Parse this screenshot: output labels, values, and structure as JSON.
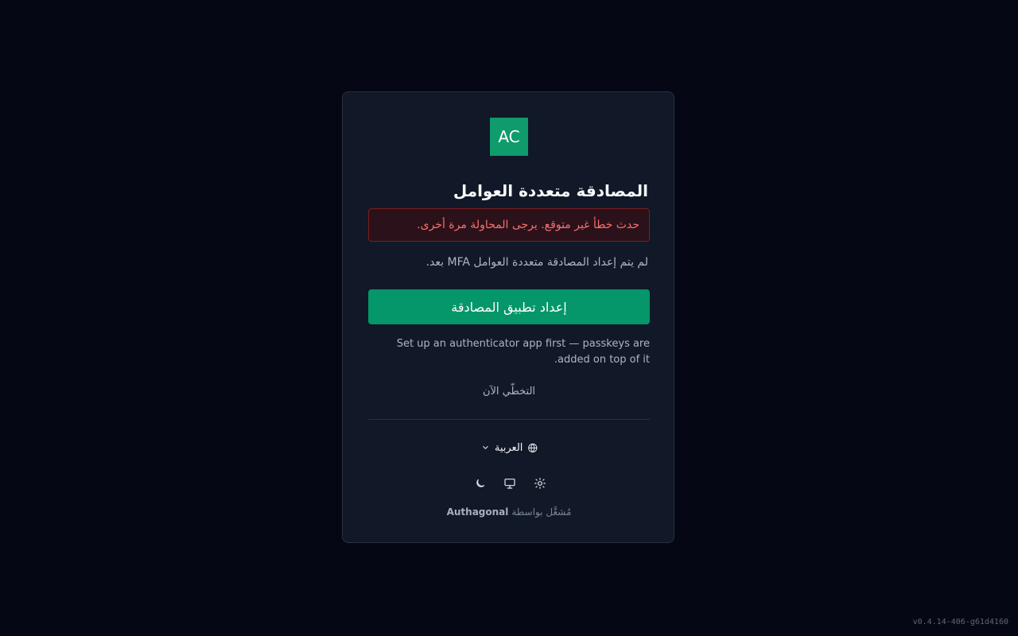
{
  "colors": {
    "background": "#050814",
    "card": "#111827",
    "brand": "#059669",
    "error_text": "#f87171",
    "error_background": "#2b1119",
    "muted_text": "#aeb5c2"
  },
  "brand": {
    "logo_text": "AC"
  },
  "mfa": {
    "title": "المصادقة متعددة العوامل",
    "error_message": "حدث خطأ غير متوقع. يرجى المحاولة مرة أخرى.",
    "status_message": "لم يتم إعداد المصادقة متعددة العوامل MFA بعد.",
    "setup_button": "إعداد تطبيق المصادقة",
    "passkey_hint": "Set up an authenticator app first — passkeys are added on top of it.",
    "skip_label": "التخطّي الآن"
  },
  "footer": {
    "language": {
      "selected": "العربية",
      "globe_icon": "globe-icon",
      "chevron_icon": "chevron-down-icon"
    },
    "theme_switcher": [
      {
        "mode": "dark",
        "icon": "moon-icon"
      },
      {
        "mode": "system",
        "icon": "monitor-icon"
      },
      {
        "mode": "light",
        "icon": "sun-icon"
      }
    ],
    "powered_by_label": "مُشغَّل بواسطة",
    "powered_by_brand": "Authagonal"
  },
  "app": {
    "version": "v0.4.14-406-g61d4160"
  }
}
